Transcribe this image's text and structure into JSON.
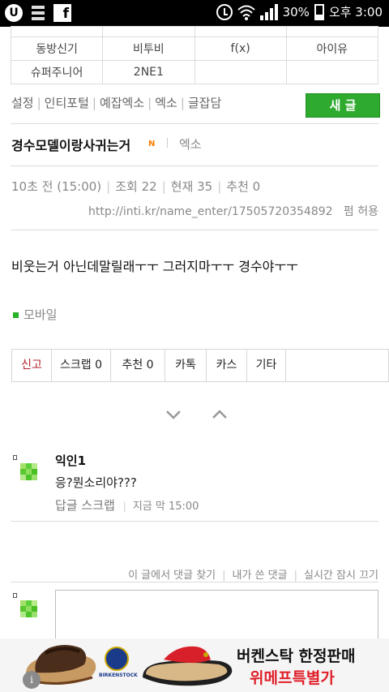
{
  "statusbar": {
    "battery": "30%",
    "time": "오후 3:00",
    "icons": [
      "u-plus-icon",
      "list-icon",
      "facebook-icon",
      "alarm-icon",
      "wifi-icon",
      "signal-icon",
      "battery-icon"
    ]
  },
  "idol_grid": {
    "rows": [
      [
        "동방신기",
        "비투비",
        "f(x)",
        "아이유"
      ],
      [
        "슈퍼주니어",
        "2NE1",
        "",
        ""
      ]
    ]
  },
  "category_nav": {
    "items": [
      "설정",
      "인티포털",
      "예잡엑소",
      "엑소",
      "글잡담"
    ],
    "new_post_label": "새 글"
  },
  "post": {
    "title": "경수모델이랑사귀는거",
    "new_badge": "N",
    "board": "엑소",
    "time": "10초 전 (15:00)",
    "views": "조회 22",
    "current": "현재 35",
    "recommend": "추천 0",
    "url": "http://inti.kr/name_enter/17505720354892",
    "share_permission": "펌 허용",
    "body": "비웃는거 아닌데말릴래ㅜㅜ 그러지마ㅜㅜ 경수야ㅜㅜ",
    "source": "모바일"
  },
  "actions": {
    "report": "신고",
    "scrap": "스크랩 0",
    "recommend": "추천 0",
    "katalk": "카톡",
    "kas": "카스",
    "etc": "기타"
  },
  "comment": {
    "author": "익인1",
    "text": "응?뭔소리야???",
    "reply": "답글",
    "scrap": "스크랩",
    "time": "지금 막 15:00"
  },
  "comment_links": {
    "find": "이 글에서 댓글 찾기",
    "mine": "내가 쓴 댓글",
    "realtime_off": "실시간 잠시 끄기"
  },
  "ad": {
    "line1": "버켄스탁 한정판매",
    "line2": "위메프특별가",
    "brand": "BIRKENSTOCK",
    "colors": {
      "accent": "#e0202a",
      "brand_green": "#2eaa2e"
    }
  }
}
